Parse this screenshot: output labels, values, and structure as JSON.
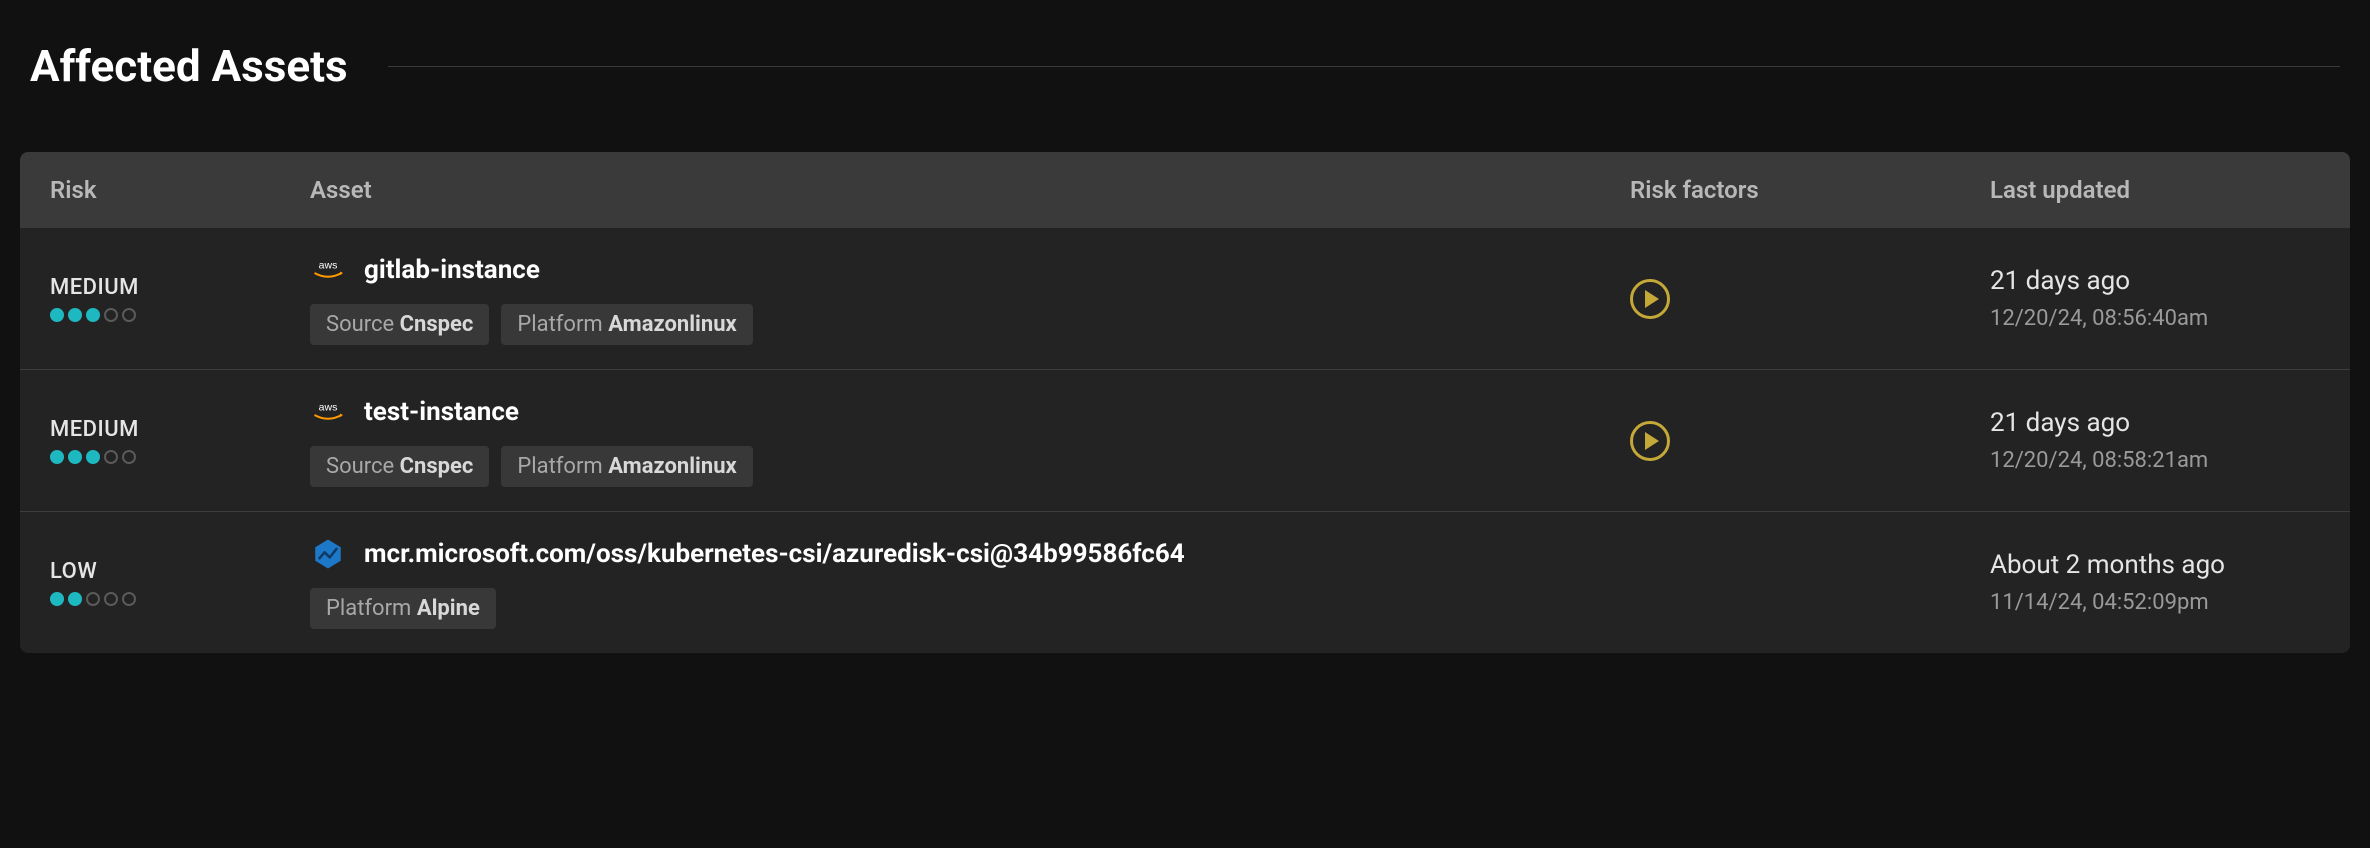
{
  "title": "Affected Assets",
  "columns": {
    "risk": "Risk",
    "asset": "Asset",
    "factors": "Risk factors",
    "updated": "Last updated"
  },
  "rows": [
    {
      "risk": {
        "label": "MEDIUM",
        "level": 3
      },
      "icon": "aws",
      "name": "gitlab-instance",
      "tags": [
        {
          "key": "Source",
          "value": "Cnspec"
        },
        {
          "key": "Platform",
          "value": "Amazonlinux"
        }
      ],
      "has_action": true,
      "updated_rel": "21 days ago",
      "updated_abs": "12/20/24, 08:56:40am"
    },
    {
      "risk": {
        "label": "MEDIUM",
        "level": 3
      },
      "icon": "aws",
      "name": "test-instance",
      "tags": [
        {
          "key": "Source",
          "value": "Cnspec"
        },
        {
          "key": "Platform",
          "value": "Amazonlinux"
        }
      ],
      "has_action": true,
      "updated_rel": "21 days ago",
      "updated_abs": "12/20/24, 08:58:21am"
    },
    {
      "risk": {
        "label": "LOW",
        "level": 2
      },
      "icon": "hex",
      "name": "mcr.microsoft.com/oss/kubernetes-csi/azuredisk-csi@34b99586fc64",
      "tags": [
        {
          "key": "Platform",
          "value": "Alpine"
        }
      ],
      "has_action": false,
      "updated_rel": "About 2 months ago",
      "updated_abs": "11/14/24, 04:52:09pm"
    }
  ]
}
